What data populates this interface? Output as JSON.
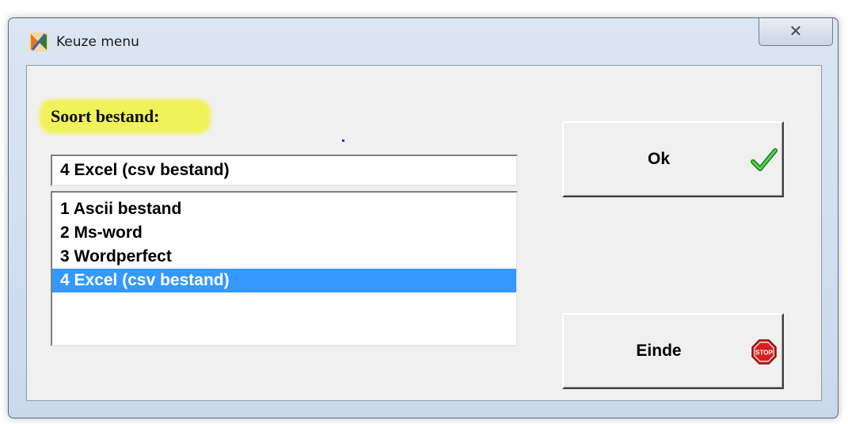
{
  "window": {
    "title": "Keuze menu",
    "close_glyph": "✕"
  },
  "form": {
    "label": "Soort bestand:",
    "combo_value": "4  Excel (csv bestand)",
    "list_items": [
      "1  Ascii bestand",
      "2  Ms-word",
      "3  Wordperfect",
      "4  Excel (csv bestand)"
    ],
    "selected_index": 3
  },
  "buttons": {
    "ok_label": "Ok",
    "ok_icon": "checkmark-icon",
    "einde_label": "Einde",
    "einde_icon": "stop-sign-icon"
  },
  "colors": {
    "selection": "#3399ff",
    "highlight": "#f2f24a",
    "check": "#2fae2f",
    "stop": "#d81e1e"
  }
}
